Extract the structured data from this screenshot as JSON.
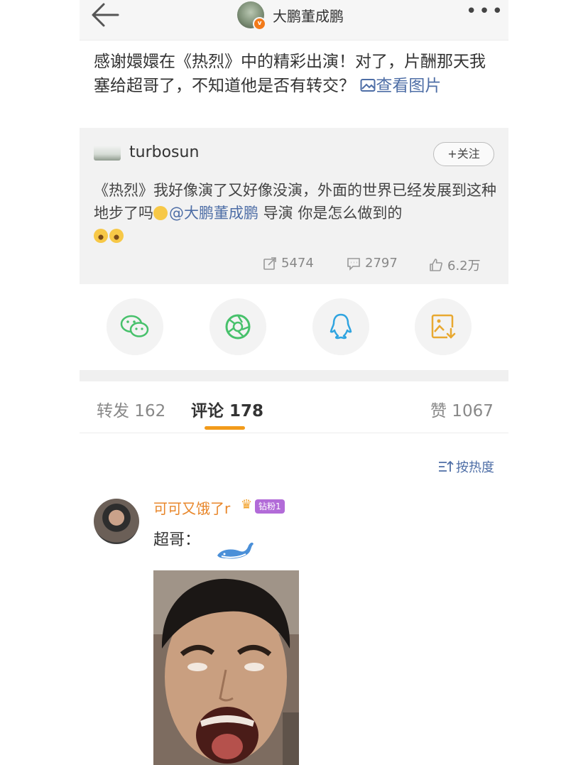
{
  "header": {
    "username": "大鹏董成鹏",
    "more_label": "•••"
  },
  "post": {
    "text": "感谢嬛嬛在《热烈》中的精彩出演！对了，片酬那天我塞给超哥了，不知道他是否有转交？",
    "view_image_label": "查看图片"
  },
  "original": {
    "username": "turbosun",
    "follow_label": "+关注",
    "text_before": "《热烈》我好像演了又好像没演，外面的世界已经发展到这种地步了吗",
    "mention": "@大鹏董成鹏",
    "text_after": " 导演 你是怎么做到的",
    "reposts": "5474",
    "comments": "2797",
    "likes": "6.2万"
  },
  "share": {
    "icons": [
      "wechat-icon",
      "moments-icon",
      "qq-icon",
      "save-image-icon"
    ]
  },
  "tabs": [
    {
      "label": "转发 162"
    },
    {
      "label": "评论 178"
    },
    {
      "label": "赞 1067"
    }
  ],
  "sort_label": "按热度",
  "comment": {
    "username": "可可又饿了r",
    "badge": "钻粉1",
    "text": "超哥："
  },
  "colors": {
    "link": "#4e6ea6",
    "accent": "#f29b1a",
    "username_orange": "#e8862a"
  }
}
